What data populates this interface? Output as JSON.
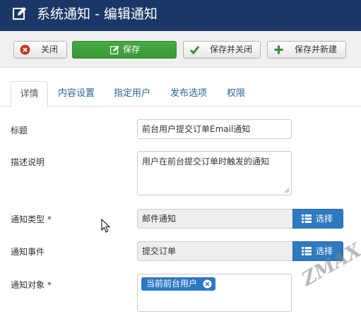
{
  "header": {
    "title": "系统通知 - 编辑通知",
    "icon": "edit-icon"
  },
  "toolbar": {
    "close_label": "关闭",
    "save_label": "保存",
    "save_close_label": "保存并关闭",
    "save_new_label": "保存并新建"
  },
  "tabs": [
    {
      "label": "详情",
      "active": true
    },
    {
      "label": "内容设置"
    },
    {
      "label": "指定用户"
    },
    {
      "label": "发布选项"
    },
    {
      "label": "权限"
    }
  ],
  "form": {
    "title_label": "标题",
    "title_value": "前台用户提交订单Email通知",
    "desc_label": "描述说明",
    "desc_value": "用户在前台提交订单时触发的通知",
    "type_label": "通知类型 *",
    "type_value": "邮件通知",
    "event_label": "通知事件",
    "event_value": "提交订单",
    "target_label": "通知对象 *",
    "target_chips": [
      "当前前台用户"
    ],
    "select_label": "选择"
  },
  "watermark": "ZMAX",
  "colors": {
    "header_bg": "#1a3867",
    "save_green": "#3a9a37",
    "select_blue": "#2f7abf",
    "close_red": "#c0392b"
  }
}
